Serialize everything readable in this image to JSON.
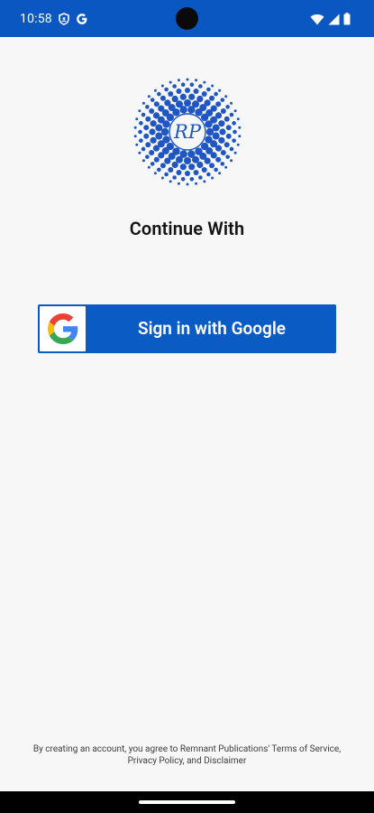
{
  "status_bar": {
    "time": "10:58",
    "icons": [
      "shield-icon",
      "google-g-icon",
      "wifi-icon",
      "cellular-signal-icon",
      "battery-icon"
    ]
  },
  "logo": {
    "monogram": "RP",
    "brand_color": "#1f56c4"
  },
  "main": {
    "title": "Continue With",
    "google_button_label": "Sign in with Google",
    "button_color": "#0a5bc4"
  },
  "footer": {
    "terms": "By creating an account, you agree to Remnant Publications' Terms of Service, Privacy Policy, and Disclaimer"
  }
}
